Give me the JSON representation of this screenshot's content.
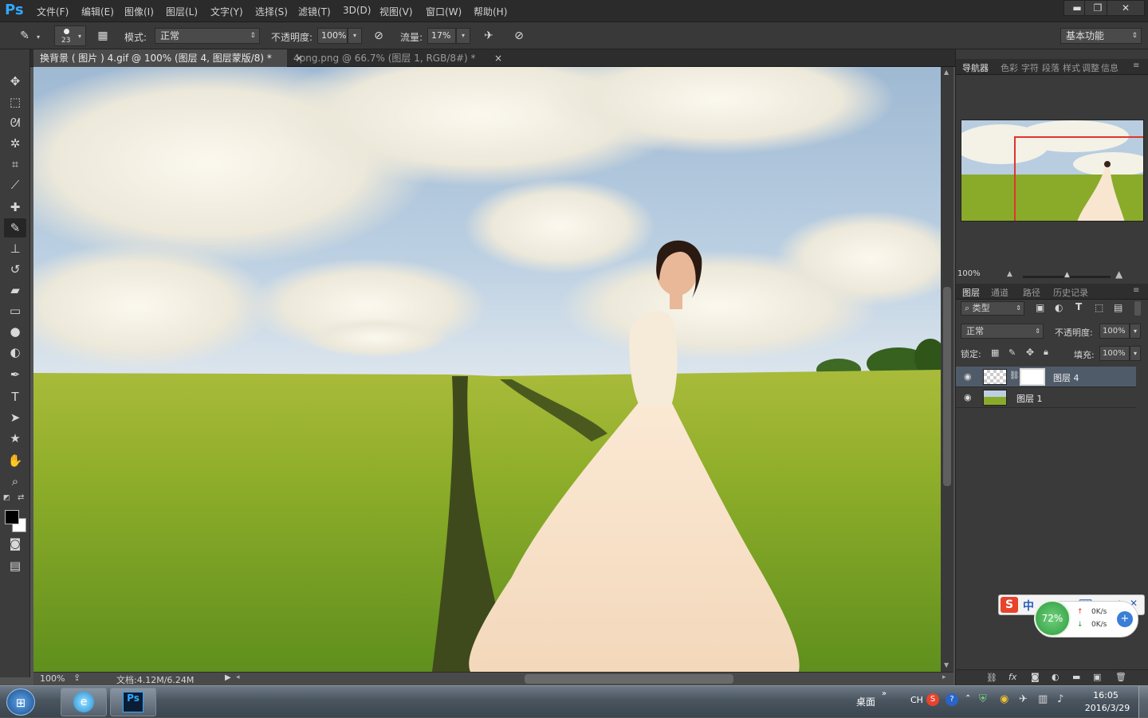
{
  "app": {
    "logo": "Ps"
  },
  "menu": [
    "文件(F)",
    "编辑(E)",
    "图像(I)",
    "图层(L)",
    "文字(Y)",
    "选择(S)",
    "滤镜(T)",
    "3D(D)",
    "视图(V)",
    "窗口(W)",
    "帮助(H)"
  ],
  "window_controls": {
    "minimize": "▬",
    "restore": "❐",
    "close": "✕"
  },
  "options": {
    "brush_size": "23",
    "mode_label": "模式:",
    "mode_value": "正常",
    "opacity_label": "不透明度:",
    "opacity_value": "100%",
    "flow_label": "流量:",
    "flow_value": "17%",
    "workspace": "基本功能"
  },
  "tabs": [
    {
      "label": "换背景 ( 图片 ) 4.gif @ 100% (图层 4, 图层蒙版/8) *",
      "close": "×"
    },
    {
      "label": "4png.png @ 66.7% (图层 1, RGB/8#) *",
      "close": "×"
    }
  ],
  "status": {
    "zoom": "100%",
    "doc_size": "文档:4.12M/6.24M"
  },
  "navigator": {
    "tabs": [
      "导航器",
      "色彩",
      "字符",
      "段落",
      "样式",
      "调整",
      "信息"
    ],
    "zoom": "100%"
  },
  "layers_panel": {
    "tabs": [
      "图层",
      "通道",
      "路径",
      "历史记录"
    ],
    "filter_label": "类型",
    "blend_mode": "正常",
    "opacity_label": "不透明度:",
    "opacity_value": "100%",
    "lock_label": "锁定:",
    "fill_label": "填充:",
    "fill_value": "100%",
    "layers": [
      {
        "name": "图层 4",
        "selected": true,
        "has_mask": true
      },
      {
        "name": "图层 1",
        "selected": false,
        "has_mask": false
      }
    ]
  },
  "ime": {
    "lang": "中"
  },
  "net_widget": {
    "percent": "72%",
    "up": "0K/s",
    "down": "0K/s"
  },
  "taskbar": {
    "desktop_label": "桌面",
    "lang": "CH",
    "time": "16:05",
    "date": "2016/3/29",
    "ps_label": "Ps"
  },
  "colors": {
    "accent": "#31a8ff",
    "panel": "#3a3a3a",
    "selected_layer": "#4f5b69"
  }
}
